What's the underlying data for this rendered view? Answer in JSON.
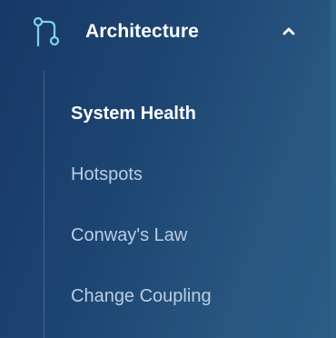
{
  "section": {
    "title": "Architecture",
    "icon": "git-branch-icon",
    "toggle_icon": "chevron-up-icon",
    "expanded": true
  },
  "nav": {
    "items": [
      {
        "label": "System Health",
        "active": true
      },
      {
        "label": "Hotspots",
        "active": false
      },
      {
        "label": "Conway's Law",
        "active": false
      },
      {
        "label": "Change Coupling",
        "active": false
      }
    ]
  },
  "colors": {
    "background_start": "#173866",
    "background_end": "#2b5d86",
    "icon_color": "#7fd3e8",
    "active_text": "#ffffff",
    "inactive_text": "#b9cde2"
  }
}
